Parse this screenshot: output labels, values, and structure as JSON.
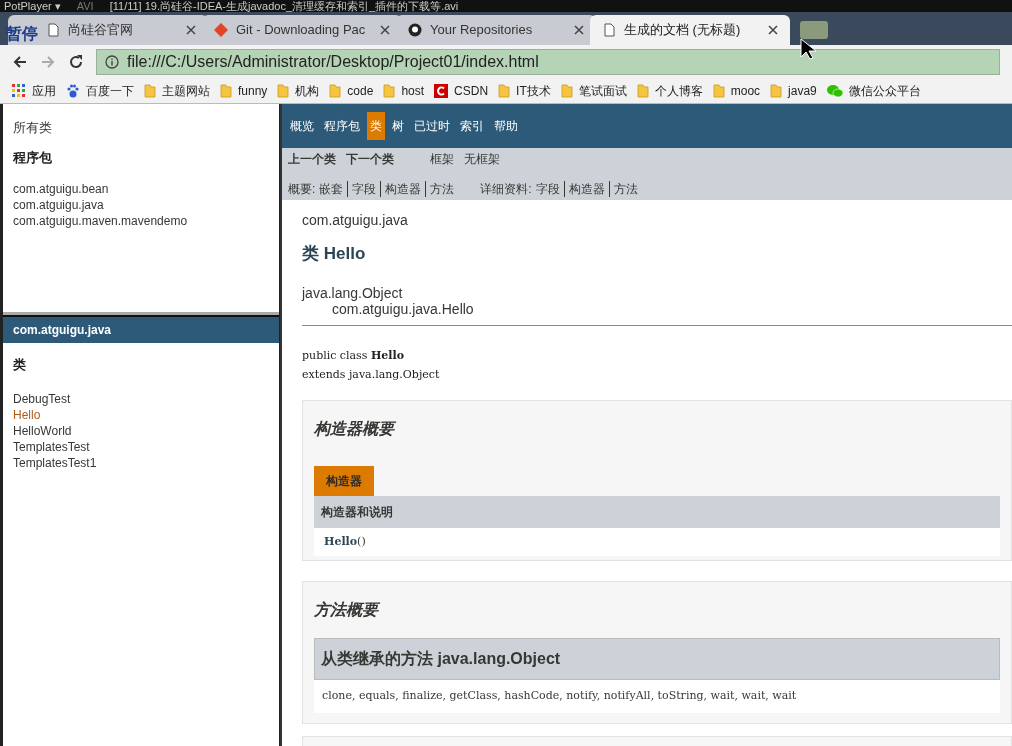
{
  "player_bar": {
    "app": "PotPlayer ▾",
    "format": "AVI",
    "title": "[11/11] 19.尚硅谷-IDEA-生成javadoc_清理缓存和索引_插件的下载等.avi"
  },
  "osd": "暂停",
  "tabs": [
    {
      "label": "尚硅谷官网",
      "kind": "page",
      "selected": false
    },
    {
      "label": "Git - Downloading Pac",
      "kind": "git",
      "selected": false
    },
    {
      "label": "Your Repositories",
      "kind": "github",
      "selected": false
    },
    {
      "label": "生成的文档 (无标题)",
      "kind": "page",
      "selected": true
    }
  ],
  "address": {
    "url": "file:///C:/Users/Administrator/Desktop/Project01/index.html"
  },
  "bookmarks": [
    {
      "label": "应用",
      "kind": "apps"
    },
    {
      "label": "百度一下",
      "kind": "paw"
    },
    {
      "label": "主题网站",
      "kind": "folder"
    },
    {
      "label": "funny",
      "kind": "folder"
    },
    {
      "label": "机构",
      "kind": "folder"
    },
    {
      "label": "code",
      "kind": "folder"
    },
    {
      "label": "host",
      "kind": "folder"
    },
    {
      "label": "CSDN",
      "kind": "csdn"
    },
    {
      "label": "IT技术",
      "kind": "folder"
    },
    {
      "label": "笔试面试",
      "kind": "folder"
    },
    {
      "label": "个人博客",
      "kind": "folder"
    },
    {
      "label": "mooc",
      "kind": "folder"
    },
    {
      "label": "java9",
      "kind": "folder"
    },
    {
      "label": "微信公众平台",
      "kind": "wechat"
    }
  ],
  "packages_frame": {
    "all_classes": "所有类",
    "heading": "程序包",
    "items": [
      "com.atguigu.bean",
      "com.atguigu.java",
      "com.atguigu.maven.mavendemo"
    ]
  },
  "classes_frame": {
    "title": "com.atguigu.java",
    "heading": "类",
    "items": [
      {
        "label": "DebugTest",
        "selected": false
      },
      {
        "label": "Hello",
        "selected": true
      },
      {
        "label": "HelloWorld",
        "selected": false
      },
      {
        "label": "TemplatesTest",
        "selected": false
      },
      {
        "label": "TemplatesTest1",
        "selected": false
      }
    ]
  },
  "nav": [
    {
      "label": "概览",
      "selected": false
    },
    {
      "label": "程序包",
      "selected": false
    },
    {
      "label": "类",
      "selected": true
    },
    {
      "label": "树",
      "selected": false
    },
    {
      "label": "已过时",
      "selected": false
    },
    {
      "label": "索引",
      "selected": false
    },
    {
      "label": "帮助",
      "selected": false
    }
  ],
  "subnav": {
    "prev_next": [
      "上一个类",
      "下一个类"
    ],
    "frames": [
      "框架",
      "无框架"
    ],
    "summary_label": "概要:",
    "summary": [
      "嵌套",
      "字段",
      "构造器",
      "方法"
    ],
    "detail_label": "详细资料:",
    "detail": [
      "字段",
      "构造器",
      "方法"
    ]
  },
  "class_doc": {
    "package": "com.atguigu.java",
    "title": "类 Hello",
    "hierarchy": [
      "java.lang.Object",
      "com.atguigu.java.Hello"
    ],
    "declaration": [
      "public class **Hello**",
      "extends java.lang.Object"
    ],
    "constructor_summary": {
      "heading": "构造器概要",
      "tab": "构造器",
      "column": "构造器和说明",
      "rows": [
        {
          "name": "Hello",
          "params": "()"
        }
      ]
    },
    "method_summary": {
      "heading": "方法概要",
      "inherited_title": "从类继承的方法 java.lang.Object",
      "inherited": "clone, equals, finalize, getClass, hashCode, notify, notifyAll, toString, wait, wait, wait"
    }
  }
}
